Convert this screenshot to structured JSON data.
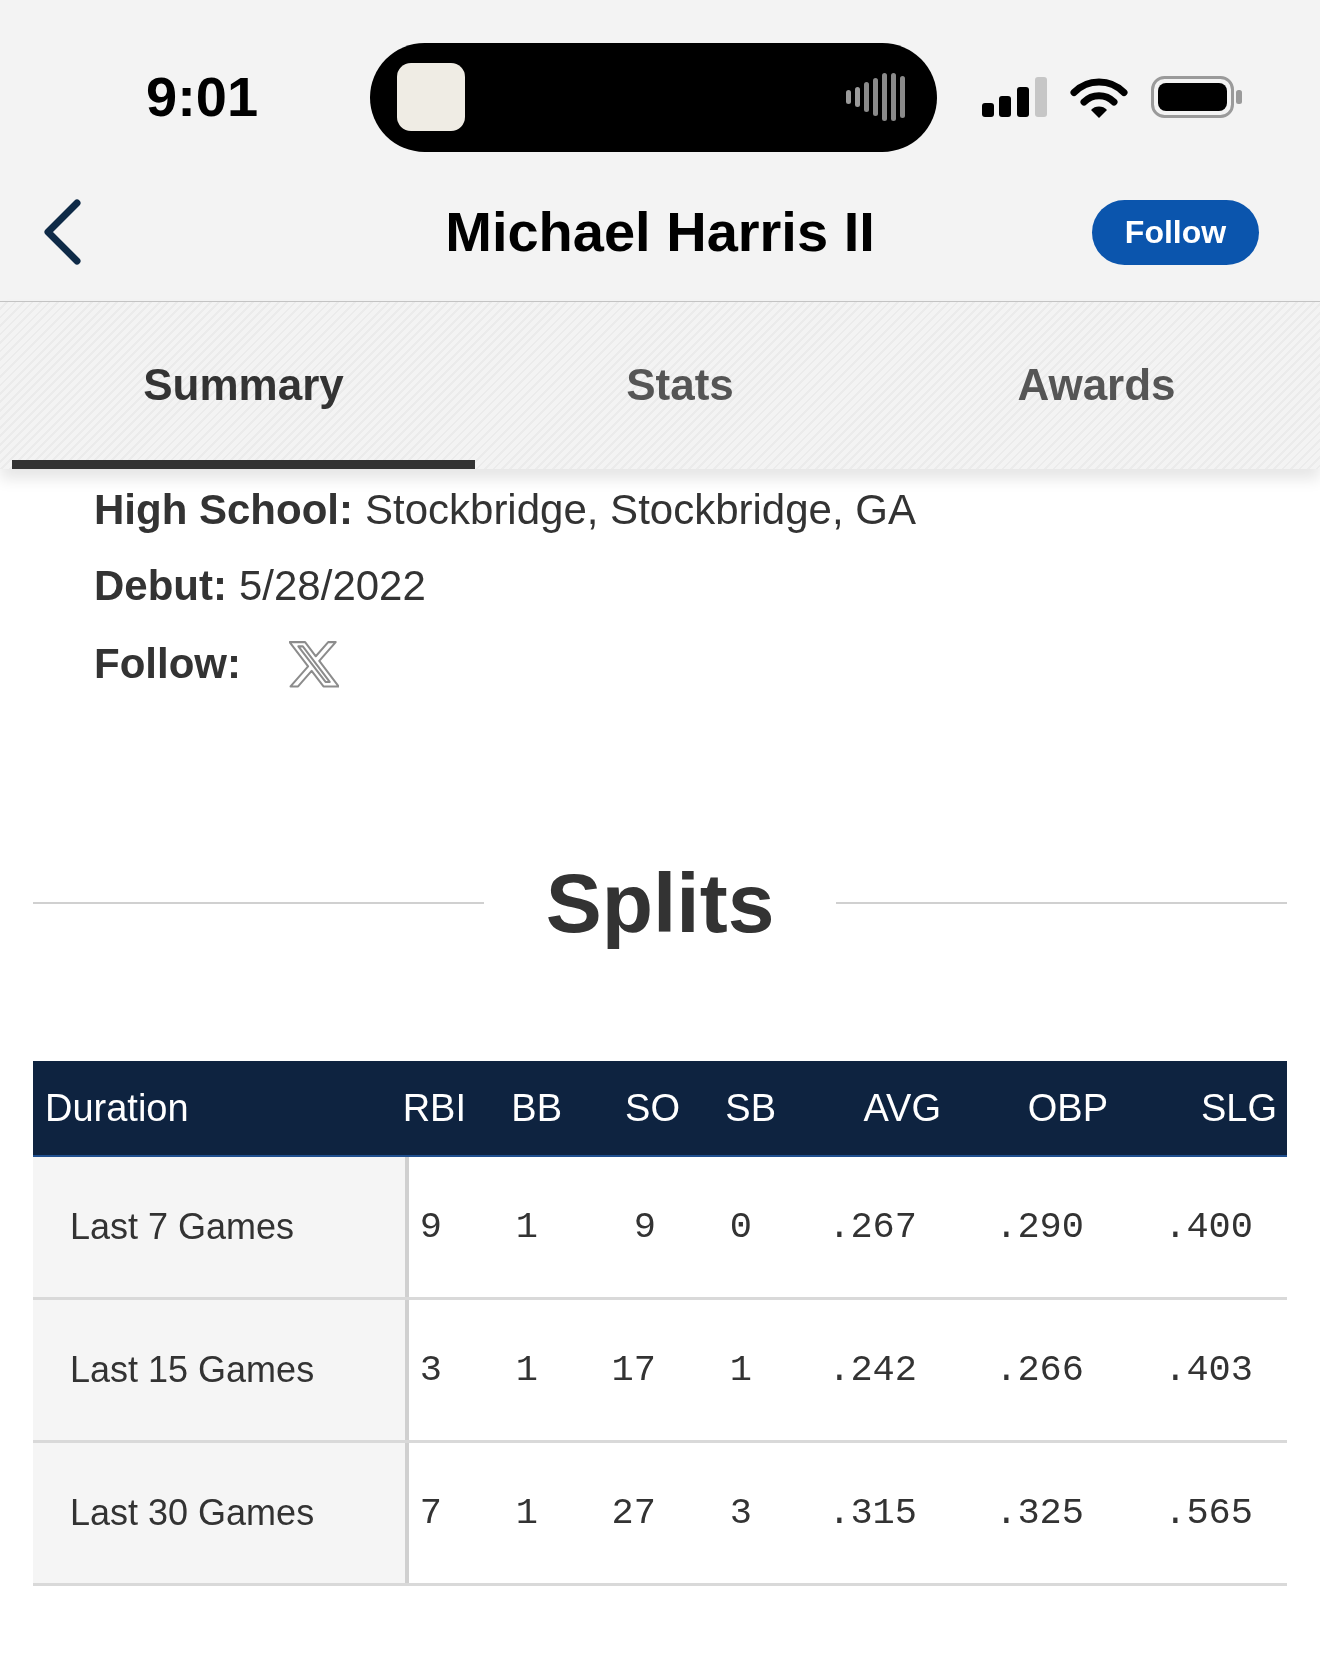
{
  "status_bar": {
    "time": "9:01"
  },
  "header": {
    "title": "Michael Harris II",
    "follow_button": "Follow"
  },
  "tabs": [
    {
      "label": "Summary",
      "selected": true
    },
    {
      "label": "Stats",
      "selected": false
    },
    {
      "label": "Awards",
      "selected": false
    }
  ],
  "bio": [
    {
      "kind": "text",
      "label": "High School:",
      "value": "Stockbridge, Stockbridge, GA"
    },
    {
      "kind": "text",
      "label": "Debut:",
      "value": "5/28/2022"
    },
    {
      "kind": "social",
      "label": "Follow:"
    }
  ],
  "splits": {
    "title": "Splits",
    "table": {
      "columns": [
        "Duration",
        "RBI",
        "BB",
        "SO",
        "SB",
        "AVG",
        "OBP",
        "SLG"
      ],
      "rows": [
        [
          "Last 7 Games",
          "9",
          "1",
          "9",
          "0",
          ".267",
          ".290",
          ".400"
        ],
        [
          "Last 15 Games",
          "3",
          "1",
          "17",
          "1",
          ".242",
          ".266",
          ".403"
        ],
        [
          "Last 30 Games",
          "7",
          "1",
          "27",
          "3",
          ".315",
          ".325",
          ".565"
        ]
      ]
    }
  }
}
